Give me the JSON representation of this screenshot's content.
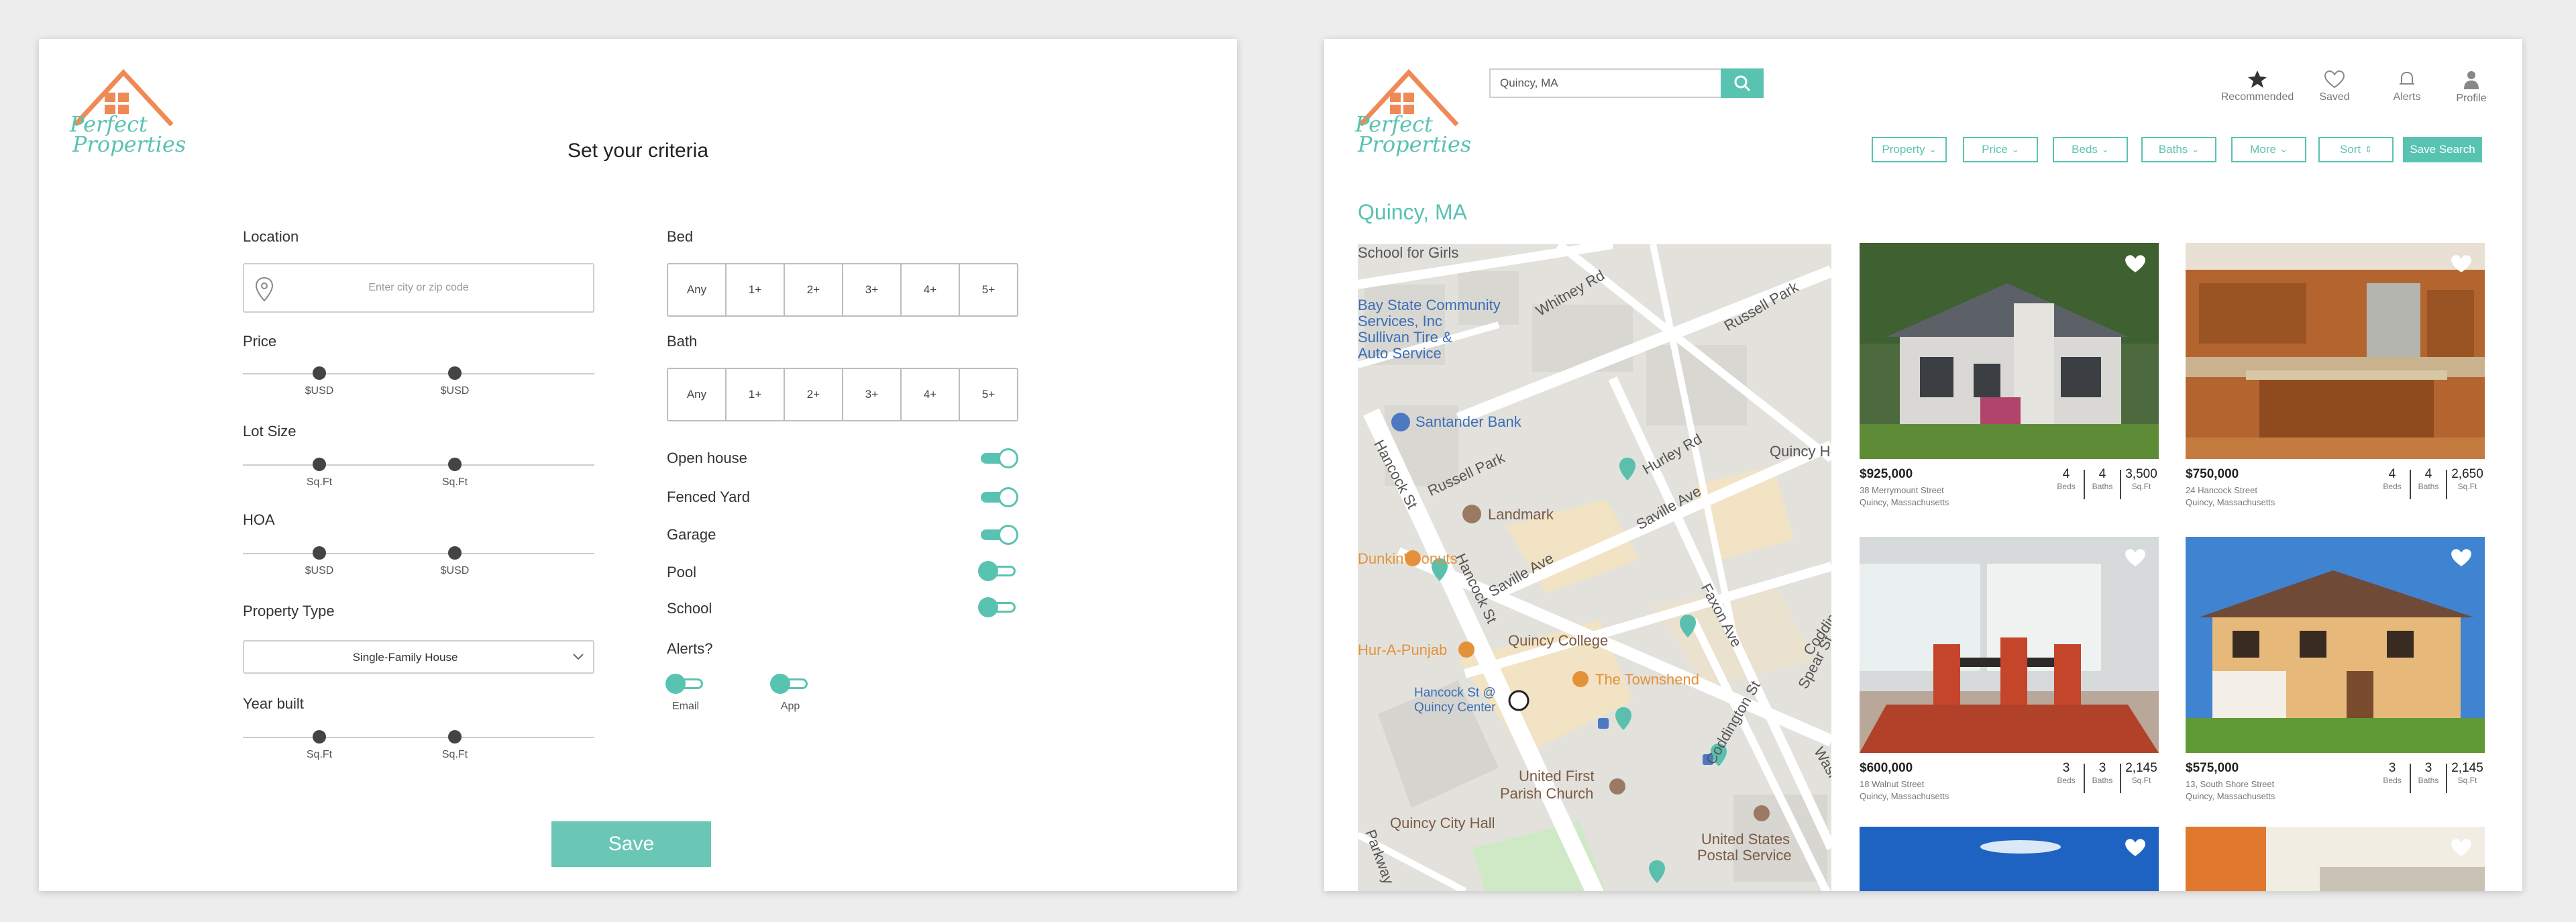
{
  "brand": {
    "line1": "Perfect",
    "line2": "Properties"
  },
  "criteria": {
    "title": "Set your criteria",
    "location": {
      "label": "Location",
      "placeholder": "Enter city or zip code"
    },
    "price": {
      "label": "Price",
      "min_unit": "$USD",
      "max_unit": "$USD"
    },
    "lot_size": {
      "label": "Lot Size",
      "min_unit": "Sq.Ft",
      "max_unit": "Sq.Ft"
    },
    "hoa": {
      "label": "HOA",
      "min_unit": "$USD",
      "max_unit": "$USD"
    },
    "property_type": {
      "label": "Property Type",
      "value": "Single-Family House"
    },
    "year_built": {
      "label": "Year built",
      "min_unit": "Sq.Ft",
      "max_unit": "Sq.Ft"
    },
    "bed": {
      "label": "Bed",
      "options": [
        "Any",
        "1+",
        "2+",
        "3+",
        "4+",
        "5+"
      ]
    },
    "bath": {
      "label": "Bath",
      "options": [
        "Any",
        "1+",
        "2+",
        "3+",
        "4+",
        "5+"
      ]
    },
    "toggles": [
      {
        "label": "Open house",
        "on": true
      },
      {
        "label": "Fenced Yard",
        "on": true
      },
      {
        "label": "Garage",
        "on": true
      },
      {
        "label": "Pool",
        "on": false
      },
      {
        "label": "School",
        "on": false
      }
    ],
    "alerts": {
      "label": "Alerts?",
      "email": "Email",
      "app": "App"
    },
    "save_label": "Save"
  },
  "results": {
    "search_value": "Quincy, MA",
    "nav": {
      "recommended": "Recommended",
      "saved": "Saved",
      "alerts": "Alerts",
      "profile": "Profile"
    },
    "filters": [
      "Property",
      "Price",
      "Beds",
      "Baths",
      "More",
      "Sort"
    ],
    "save_search": "Save Search",
    "title": "Quincy, MA",
    "map_labels": {
      "school_for_girls": "School for Girls",
      "bay_state_1": "Bay State Community",
      "bay_state_2": "Services, Inc",
      "tire_1": "Sullivan Tire &",
      "tire_2": "Auto Service",
      "whitney": "Whitney Rd",
      "russell_park_1": "Russell Park",
      "russell_park_2": "Russell Park",
      "santander": "Santander Bank",
      "hancock_st_1": "Hancock St",
      "hancock_st_2": "Hancock St",
      "hurley": "Hurley Rd",
      "quincy_h": "Quincy H",
      "landmark": "Landmark",
      "saville_1": "Saville Ave",
      "saville_2": "Saville Ave",
      "bucks": "Dunkin' Donuts",
      "punjab": "Hur-A-Punjab",
      "quincy_college": "Quincy College",
      "faxon": "Faxon Ave",
      "coddington_1": "Coddington St",
      "coddington_2": "Coddington St",
      "townshend": "The Townshend",
      "quincy_center_1": "Hancock St @",
      "quincy_center_2": "Quincy Center",
      "spear": "Spear St",
      "washington": "Washington St",
      "united_first_1": "United First",
      "united_first_2": "Parish Church",
      "city_hall": "Quincy City Hall",
      "postal_1": "United States",
      "postal_2": "Postal Service",
      "parkway": "Parkway"
    },
    "listings": [
      {
        "price": "$925,000",
        "address1": "38 Merrymount Street",
        "address2": "Quincy, Massachusetts",
        "beds": "4",
        "baths": "4",
        "sqft": "3,500",
        "beds_unit": "Beds",
        "baths_unit": "Baths",
        "sqft_unit": "Sq.Ft"
      },
      {
        "price": "$750,000",
        "address1": "24 Hancock Street",
        "address2": "Quincy, Massachusetts",
        "beds": "4",
        "baths": "4",
        "sqft": "2,650",
        "beds_unit": "Beds",
        "baths_unit": "Baths",
        "sqft_unit": "Sq.Ft"
      },
      {
        "price": "$600,000",
        "address1": "18 Walnut Street",
        "address2": "Quincy, Massachusetts",
        "beds": "3",
        "baths": "3",
        "sqft": "2,145",
        "beds_unit": "Beds",
        "baths_unit": "Baths",
        "sqft_unit": "Sq.Ft"
      },
      {
        "price": "$575,000",
        "address1": "13, South Shore Street",
        "address2": "Quincy, Massachusetts",
        "beds": "3",
        "baths": "3",
        "sqft": "2,145",
        "beds_unit": "Beds",
        "baths_unit": "Baths",
        "sqft_unit": "Sq.Ft"
      }
    ]
  },
  "colors": {
    "accent": "#59c3b1",
    "logo_orange": "#ef8a57",
    "handle": "#444444"
  }
}
